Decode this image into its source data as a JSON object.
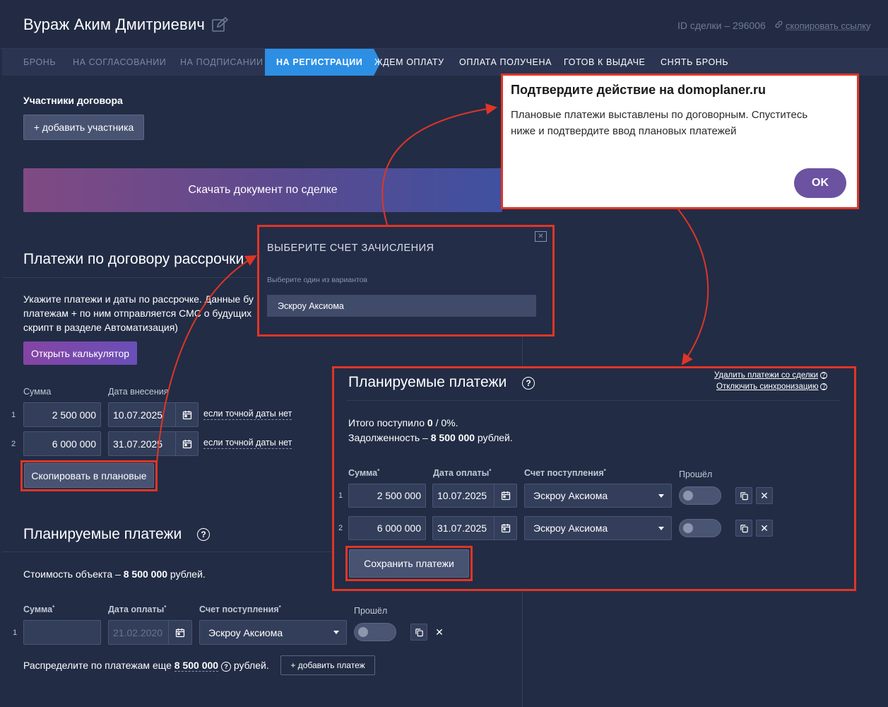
{
  "header": {
    "person_name": "Вураж Аким Дмитриевич",
    "deal_id": "ID сделки – 296006",
    "copy_link": "скопировать ссылку"
  },
  "tabs": [
    {
      "label": "БРОНЬ",
      "state": "done"
    },
    {
      "label": "НА СОГЛАСОВАНИИ",
      "state": "done"
    },
    {
      "label": "НА ПОДПИСАНИИ",
      "state": "done"
    },
    {
      "label": "НА РЕГИСТРАЦИИ",
      "state": "active"
    },
    {
      "label": "ЖДЕМ ОПЛАТУ",
      "state": "future"
    },
    {
      "label": "ОПЛАТА ПОЛУЧЕНА",
      "state": "future"
    },
    {
      "label": "ГОТОВ К ВЫДАЧЕ",
      "state": "future"
    },
    {
      "label": "СНЯТЬ БРОНЬ",
      "state": "future"
    }
  ],
  "participants": {
    "title": "Участники договора",
    "add_button": "+ добавить участника"
  },
  "download_button": "Скачать документ по сделке",
  "installments": {
    "title": "Платежи по договору рассрочки",
    "desc_line1": "Укажите платежи и даты по рассрочке. Данные бу",
    "desc_line2": "платежам + по ним отправляется СМС о будущих",
    "desc_line3": "скрипт в разделе Автоматизация)",
    "calc_button": "Открыть калькулятор",
    "col_amount": "Сумма",
    "col_date": "Дата внесения",
    "no_date_link": "если точной даты нет",
    "rows": [
      {
        "num": "1",
        "amount": "2 500 000",
        "date": "10.07.2025"
      },
      {
        "num": "2",
        "amount": "6 000 000",
        "date": "31.07.2025"
      }
    ],
    "copy_button": "Скопировать в плановые"
  },
  "planned_left": {
    "title": "Планируемые платежи",
    "cost_prefix": "Стоимость объекта – ",
    "cost_value": "8 500 000",
    "cost_suffix": " рублей.",
    "col_amount": "Сумма",
    "col_date": "Дата оплаты",
    "col_account": "Счет поступления",
    "col_passed": "Прошёл",
    "row": {
      "num": "1",
      "amount": "",
      "date_placeholder": "21.02.2020",
      "account": "Эскроу Аксиома"
    },
    "distribute_prefix": "Распределите по платежам еще ",
    "distribute_value": "8 500 000",
    "distribute_suffix": " рублей.",
    "add_payment_button": "+ добавить платеж"
  },
  "account_modal": {
    "title": "ВЫБЕРИТЕ СЧЕТ ЗАЧИСЛЕНИЯ",
    "hint": "Выберите один из вариантов",
    "option": "Эскроу Аксиома"
  },
  "confirm_dialog": {
    "title": "Подтвердите действие на domoplaner.ru",
    "message_line1": "Плановые платежи выставлены по договорным. Спуститесь",
    "message_line2": "ниже и подтвердите ввод плановых платежей",
    "ok": "OK"
  },
  "planned_right": {
    "title": "Планируемые платежи",
    "delete_link": "Удалить платежи со сделки",
    "disable_sync_link": "Отключить синхронизацию",
    "received_prefix": "Итого поступило ",
    "received_value": "0",
    "received_suffix": " / 0%.",
    "debt_prefix": "Задолженность – ",
    "debt_value": "8 500 000",
    "debt_suffix": " рублей.",
    "col_amount": "Сумма",
    "col_date": "Дата оплаты",
    "col_account": "Счет поступления",
    "col_passed": "Прошёл",
    "rows": [
      {
        "num": "1",
        "amount": "2 500 000",
        "date": "10.07.2025",
        "account": "Эскроу Аксиома"
      },
      {
        "num": "2",
        "amount": "6 000 000",
        "date": "31.07.2025",
        "account": "Эскроу Аксиома"
      }
    ],
    "save_button": "Сохранить платежи"
  },
  "colors": {
    "background": "#222c45",
    "active_tab": "#2d8fe4",
    "annotation_red": "#e03526",
    "ok_button": "#6b53a1"
  }
}
